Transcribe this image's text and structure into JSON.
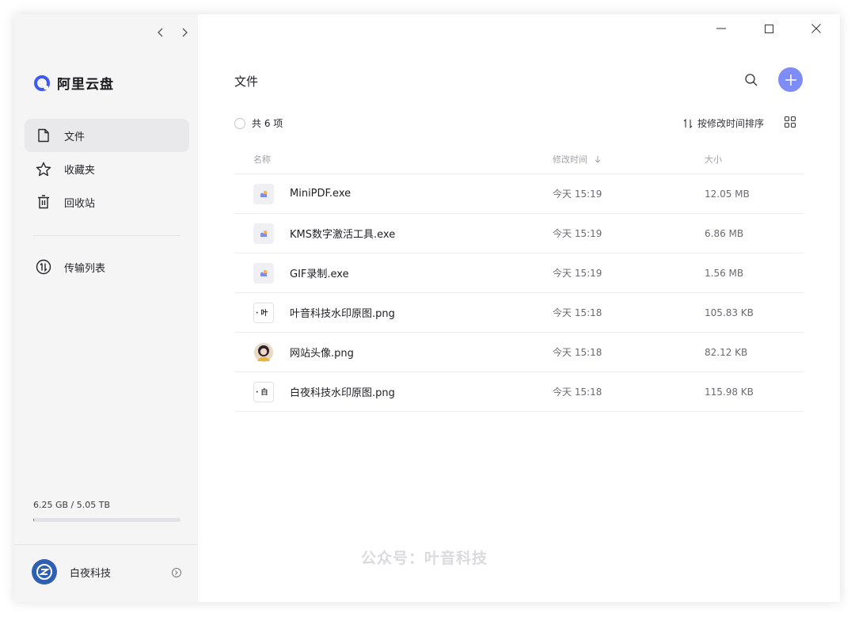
{
  "sidebar": {
    "brand": "阿里云盘",
    "items": [
      {
        "label": "文件",
        "icon": "file-icon",
        "active": true
      },
      {
        "label": "收藏夹",
        "icon": "star-icon",
        "active": false
      },
      {
        "label": "回收站",
        "icon": "trash-icon",
        "active": false
      }
    ],
    "transfer": {
      "label": "传输列表",
      "icon": "transfer-icon"
    },
    "storage": {
      "text": "6.25 GB / 5.05 TB",
      "used_fraction": 0.0012
    },
    "user": {
      "name": "白夜科技"
    }
  },
  "main": {
    "title": "文件",
    "count_label": "共 6 项",
    "sort_label": "按修改时间排序",
    "columns": {
      "name": "名称",
      "time": "修改时间",
      "size": "大小"
    },
    "files": [
      {
        "name": "MiniPDF.exe",
        "time": "今天 15:19",
        "size": "12.05 MB",
        "type": "exe"
      },
      {
        "name": "KMS数字激活工具.exe",
        "time": "今天 15:19",
        "size": "6.86 MB",
        "type": "exe"
      },
      {
        "name": "GIF录制.exe",
        "time": "今天 15:19",
        "size": "1.56 MB",
        "type": "exe"
      },
      {
        "name": "叶音科技水印原图.png",
        "time": "今天 15:18",
        "size": "105.83 KB",
        "type": "thumb",
        "thumb_text": "· 叶"
      },
      {
        "name": "网站头像.png",
        "time": "今天 15:18",
        "size": "82.12 KB",
        "type": "photo"
      },
      {
        "name": "白夜科技水印原图.png",
        "time": "今天 15:18",
        "size": "115.98 KB",
        "type": "thumb",
        "thumb_text": "· 白"
      }
    ]
  },
  "watermark": "公众号：叶音科技",
  "colors": {
    "accent": "#7e8cf7",
    "brand_blue": "#3d5af1",
    "sidebar_bg": "#f5f5f6"
  }
}
